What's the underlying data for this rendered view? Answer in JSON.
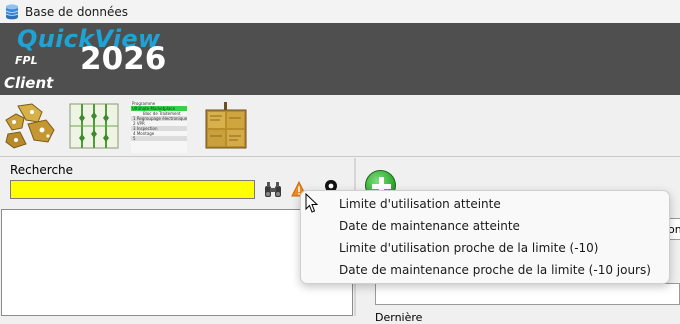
{
  "window": {
    "title": "Base de données"
  },
  "banner": {
    "brand": "QuickView",
    "fpl": "FPL",
    "year": "2026",
    "client": "Client"
  },
  "toolbar": {
    "thumb3": {
      "title": "Programme",
      "highlight": "Ultimate-Marketplace",
      "lines": [
        "Bloc de Traitement",
        "1 Regroupage électronique",
        "2 VPR",
        "3 Inspection",
        "4 Montage",
        "5"
      ]
    }
  },
  "search": {
    "label": "Recherche",
    "value": ""
  },
  "right": {
    "right_text": "ion",
    "lower_label": "Dernière"
  },
  "menu": {
    "items": [
      "Limite d'utilisation atteinte",
      "Date de maintenance atteinte",
      "Limite d'utilisation proche de la limite (-10)",
      "Date de maintenance proche de la limite (-10 jours)"
    ]
  },
  "colors": {
    "banner": "#4f4f4f",
    "brand": "#1ea3d6",
    "search_bg": "#ffff00",
    "warning": "#f08a24"
  }
}
